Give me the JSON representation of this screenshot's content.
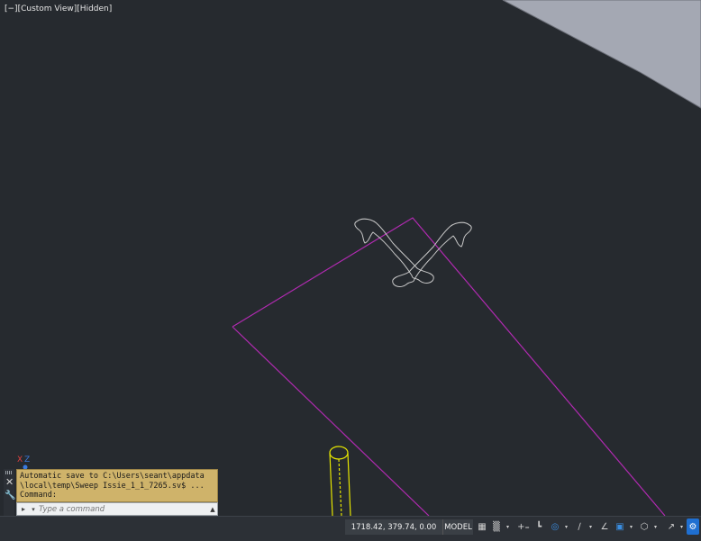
{
  "viewport": {
    "label": "[−][Custom View][Hidden]",
    "background": "#262a2f",
    "profile_color": "#c8c8c8",
    "path_color": "#b02ab0",
    "pipe_color": "#e6e600"
  },
  "ucs_icon": {
    "icon": "ucs-axis-icon",
    "x_label": "X",
    "z_label": "Z"
  },
  "command_window": {
    "history": [
      "Automatic save to C:\\Users\\seant\\appdata",
      "\\local\\temp\\Sweep Issie_1_1_7265.sv$ ...",
      "Command:"
    ],
    "input_placeholder": "Type a command",
    "close_label": "✕",
    "customize_icon": "wrench-icon",
    "background": "#cfb36a"
  },
  "statusbar": {
    "coordinates": "1718.42, 379.74, 0.00",
    "model_label": "MODEL",
    "icons": [
      {
        "name": "grid-icon",
        "glyph": "▦"
      },
      {
        "name": "snap-icon",
        "glyph": "▒"
      },
      {
        "name": "infer-constraints-icon",
        "glyph": "+₌"
      },
      {
        "name": "ortho-icon",
        "glyph": "┗"
      },
      {
        "name": "polar-tracking-icon",
        "glyph": "◎"
      },
      {
        "name": "object-snap-tracking-icon",
        "glyph": "∕"
      },
      {
        "name": "isodraft-icon",
        "glyph": "∠"
      },
      {
        "name": "dynamic-ucs-icon",
        "glyph": "▣"
      },
      {
        "name": "selection-cycling-icon",
        "glyph": "⬡"
      },
      {
        "name": "annotation-scale-icon",
        "glyph": "↗"
      },
      {
        "name": "workspace-icon",
        "glyph": "⚙"
      }
    ],
    "active_color": "#1f6fd1"
  }
}
